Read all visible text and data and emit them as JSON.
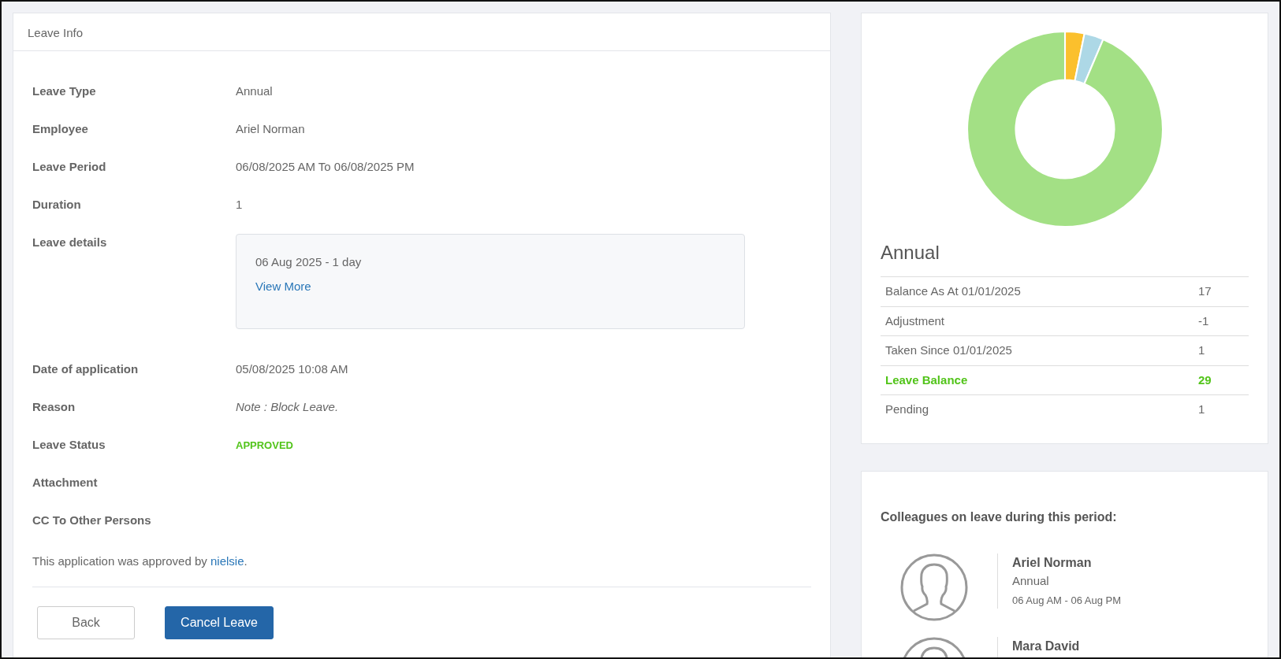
{
  "leave_info": {
    "title": "Leave Info",
    "fields": [
      {
        "label": "Leave Type",
        "value": "Annual",
        "kind": "text"
      },
      {
        "label": "Employee",
        "value": "Ariel Norman",
        "kind": "text"
      },
      {
        "label": "Leave Period",
        "value": "06/08/2025 AM To 06/08/2025 PM",
        "kind": "text"
      },
      {
        "label": "Duration",
        "value": "1",
        "kind": "text"
      },
      {
        "label": "Leave details",
        "kind": "details",
        "details": {
          "text": "06 Aug 2025 - 1 day",
          "link": "View More"
        }
      },
      {
        "label": "Date of application",
        "value": "05/08/2025 10:08 AM",
        "kind": "text"
      },
      {
        "label": "Reason",
        "value": "Note : Block Leave.",
        "kind": "italic"
      },
      {
        "label": "Leave Status",
        "value": "APPROVED",
        "kind": "status",
        "color": "#52c41a"
      },
      {
        "label": "Attachment",
        "kind": "empty"
      },
      {
        "label": "CC To Other Persons",
        "kind": "empty"
      }
    ],
    "approval": {
      "text": "This application was approved by",
      "approver": "nielsie",
      "end": "."
    },
    "buttons": [
      {
        "label": "Back",
        "kind": "secondary"
      },
      {
        "label": "Cancel Leave",
        "kind": "primary"
      }
    ]
  },
  "balance": {
    "title": "Annual",
    "rows": [
      {
        "label": "Balance As At 01/01/2025",
        "value": "17",
        "highlight": false
      },
      {
        "label": "Adjustment",
        "value": "-1",
        "highlight": false
      },
      {
        "label": "Taken Since 01/01/2025",
        "value": "1",
        "highlight": false
      },
      {
        "label": "Leave Balance",
        "value": "29",
        "highlight": true
      },
      {
        "label": "Pending",
        "value": "1",
        "highlight": false
      }
    ]
  },
  "colleagues": {
    "title": "Colleagues on leave during this period:",
    "items": [
      {
        "name": "Ariel Norman",
        "type": "Annual",
        "period": "06 Aug AM - 06 Aug PM"
      },
      {
        "name": "Mara David"
      }
    ]
  }
}
